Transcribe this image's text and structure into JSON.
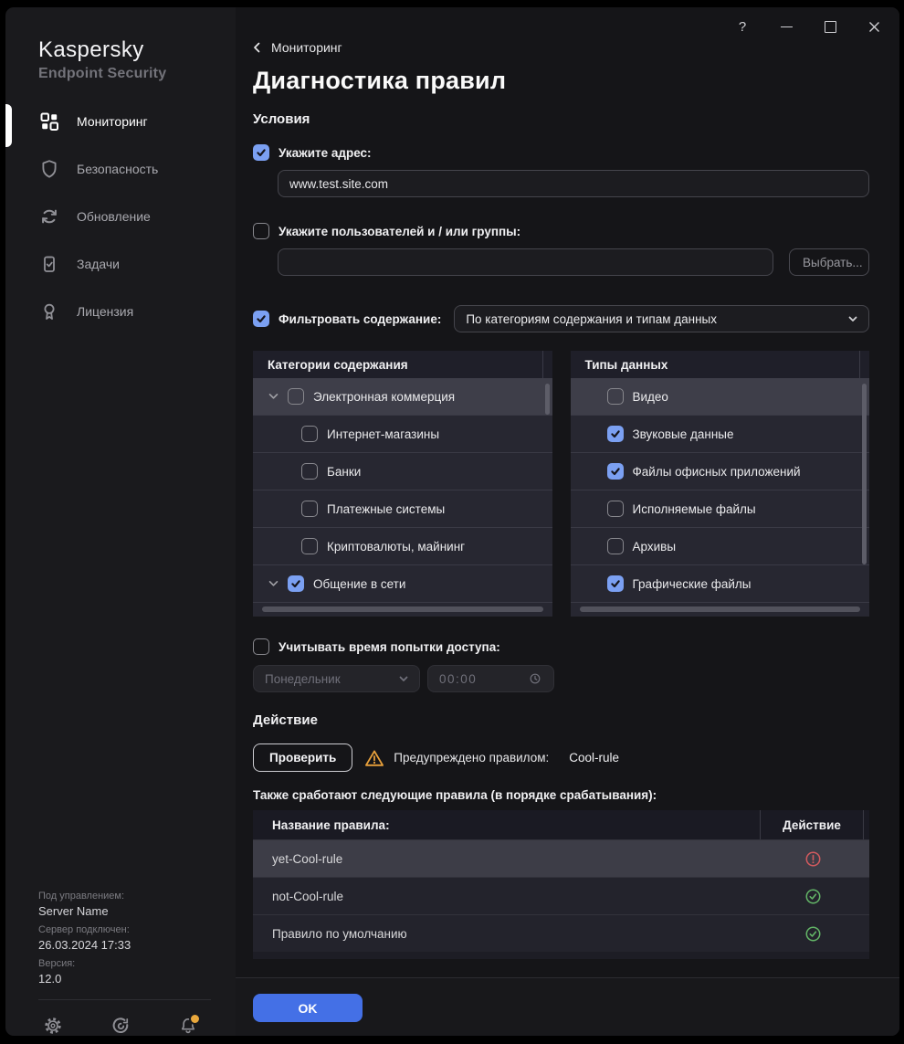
{
  "window": {
    "controls": {
      "help": "?",
      "minimize_icon": "minimize-icon",
      "maximize_icon": "maximize-icon",
      "close_icon": "close-icon"
    }
  },
  "sidebar": {
    "brand_line1": "Kaspersky",
    "brand_line2": "Endpoint Security",
    "nav": [
      {
        "label": "Мониторинг",
        "icon": "dashboard-icon",
        "active": true
      },
      {
        "label": "Безопасность",
        "icon": "shield-icon",
        "active": false
      },
      {
        "label": "Обновление",
        "icon": "refresh-icon",
        "active": false
      },
      {
        "label": "Задачи",
        "icon": "clipboard-check-icon",
        "active": false
      },
      {
        "label": "Лицензия",
        "icon": "award-icon",
        "active": false
      }
    ],
    "server_info": {
      "managed_label": "Под управлением:",
      "managed_value": "Server Name",
      "connected_label": "Сервер подключен:",
      "connected_value": "26.03.2024 17:33",
      "version_label": "Версия:",
      "version_value": "12.0"
    },
    "footer_icons": [
      "gear-icon",
      "support-icon",
      "bell-icon"
    ],
    "notification_dot": true
  },
  "main": {
    "back_label": "Мониторинг",
    "title": "Диагностика правил",
    "conditions": {
      "heading": "Условия",
      "address": {
        "label": "Укажите адрес:",
        "value": "www.test.site.com",
        "checked": true
      },
      "users": {
        "label": "Укажите пользователей и / или группы:",
        "value": "",
        "button_label": "Выбрать...",
        "checked": false
      },
      "filter": {
        "label": "Фильтровать содержание:",
        "selected_option": "По категориям содержания и типам данных",
        "checked": true
      }
    },
    "categories_panel": {
      "header": "Категории содержания",
      "rows": [
        {
          "label": "Электронная коммерция",
          "type": "parent",
          "expanded": true,
          "checked": false,
          "selected": true
        },
        {
          "label": "Интернет-магазины",
          "type": "child",
          "checked": false,
          "selected": false
        },
        {
          "label": "Банки",
          "type": "child",
          "checked": false,
          "selected": false
        },
        {
          "label": "Платежные системы",
          "type": "child",
          "checked": false,
          "selected": false
        },
        {
          "label": "Криптовалюты, майнинг",
          "type": "child",
          "checked": false,
          "selected": false
        },
        {
          "label": "Общение в сети",
          "type": "parent",
          "expanded": true,
          "checked": true,
          "selected": false
        }
      ]
    },
    "datatypes_panel": {
      "header": "Типы данных",
      "rows": [
        {
          "label": "Видео",
          "checked": false,
          "selected": true
        },
        {
          "label": "Звуковые данные",
          "checked": true,
          "selected": false
        },
        {
          "label": "Файлы офисных приложений",
          "checked": true,
          "selected": false
        },
        {
          "label": "Исполняемые файлы",
          "checked": false,
          "selected": false
        },
        {
          "label": "Архивы",
          "checked": false,
          "selected": false
        },
        {
          "label": "Графические файлы",
          "checked": true,
          "selected": false
        }
      ]
    },
    "time": {
      "label": "Учитывать время попытки доступа:",
      "checked": false,
      "day_value": "Понедельник",
      "time_value": "00:00",
      "clock_icon": "clock-icon"
    },
    "action": {
      "heading": "Действие",
      "check_button": "Проверить",
      "warning_icon": "warning-icon",
      "warning_label": "Предупреждено правилом:",
      "warning_rule": "Cool-rule"
    },
    "rules_table": {
      "caption": "Также сработают следующие правила (в порядке срабатывания):",
      "col_name": "Название правила:",
      "col_action": "Действие",
      "rows": [
        {
          "name": "yet-Cool-rule",
          "action": "blocked",
          "icon": "blocked-icon",
          "selected": true
        },
        {
          "name": "not-Cool-rule",
          "action": "allowed",
          "icon": "allowed-icon",
          "selected": false
        },
        {
          "name": "Правило по умолчанию",
          "action": "allowed",
          "icon": "allowed-icon",
          "selected": false
        }
      ]
    },
    "footer": {
      "ok_label": "OK"
    }
  },
  "colors": {
    "accent_checkbox": "#7ba0f2",
    "ok_button": "#4470e6",
    "warning": "#e9a13b",
    "blocked": "#d25a5e",
    "allowed": "#63b567",
    "notification_dot": "#e9a83c",
    "active_indicator": "#ffffff",
    "window_bg": "#1a1a1d",
    "content_bg": "#151518"
  }
}
